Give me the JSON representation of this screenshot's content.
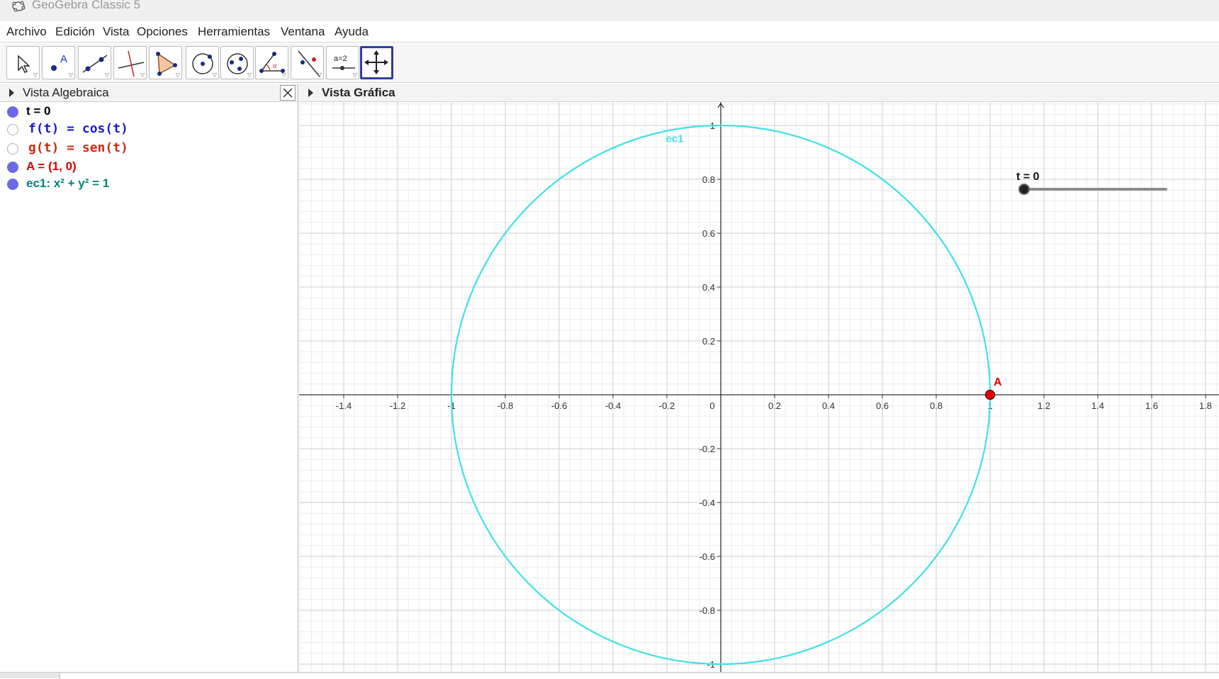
{
  "window": {
    "title": "GeoGebra Classic 5"
  },
  "menu": [
    "Archivo",
    "Edición",
    "Vista",
    "Opciones",
    "Herramientas",
    "Ventana",
    "Ayuda"
  ],
  "toolbar": {
    "tools": [
      {
        "name": "move-tool"
      },
      {
        "name": "point-tool"
      },
      {
        "name": "line-tool"
      },
      {
        "name": "perpendicular-tool"
      },
      {
        "name": "polygon-tool"
      },
      {
        "name": "circle-tool"
      },
      {
        "name": "ellipse-tool"
      },
      {
        "name": "angle-tool"
      },
      {
        "name": "reflect-tool"
      },
      {
        "name": "slider-tool",
        "label": "a=2"
      },
      {
        "name": "move-graphics-view-tool"
      }
    ],
    "selected_index": 10
  },
  "algebra_view": {
    "title": "Vista Algebraica",
    "items": [
      {
        "text": "t = 0",
        "color": "#000000",
        "visible": true,
        "mono": false
      },
      {
        "text": "f(t) = cos(t)",
        "color": "#1b1bd6",
        "visible": false,
        "mono": true
      },
      {
        "text": "g(t) = sen(t)",
        "color": "#cc2a14",
        "visible": false,
        "mono": true
      },
      {
        "text": "A = (1, 0)",
        "color": "#d40000",
        "visible": true,
        "mono": false
      },
      {
        "text": "ec1: x² + y² = 1",
        "color": "#008080",
        "visible": true,
        "mono": false
      }
    ]
  },
  "graphics_view": {
    "title": "Vista Gráfica",
    "circle_label": "ec1",
    "circle_color": "#40e0e8",
    "point_label": "A",
    "point_color": "#e00000",
    "slider_label": "t = 0",
    "slider_value_fraction": 0,
    "x_ticks": [
      "-1.4",
      "-1.2",
      "-1",
      "-0.8",
      "-0.6",
      "-0.4",
      "-0.2",
      "0",
      "0.2",
      "0.4",
      "0.6",
      "0.8",
      "1",
      "1.2",
      "1.4",
      "1.6",
      "1.8"
    ],
    "y_ticks": [
      "1",
      "0.8",
      "0.6",
      "0.4",
      "0.2",
      "-0.2",
      "-0.4",
      "-0.6",
      "-0.8",
      "-1"
    ]
  }
}
